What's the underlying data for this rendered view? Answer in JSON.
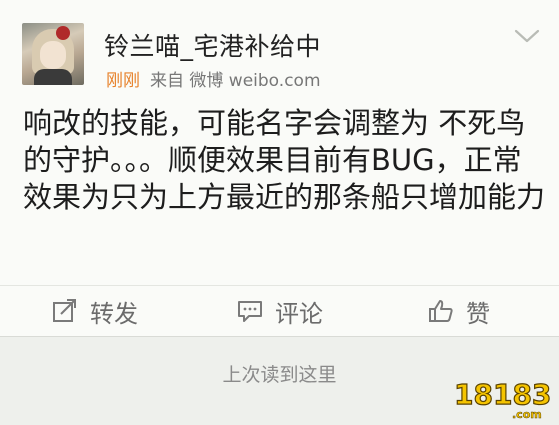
{
  "post": {
    "username": "铃兰喵_宅港补给中",
    "time": "刚刚",
    "source": "来自 微博 weibo.com",
    "content": "响改的技能，可能名字会调整为 不死鸟的守护。。。顺便效果目前有BUG，正常效果为只为上方最近的那条船只增加能力"
  },
  "actions": {
    "repost": "转发",
    "comment": "评论",
    "like": "赞"
  },
  "feed": {
    "last_read": "上次读到这里"
  },
  "watermark": {
    "text": "18183",
    "suffix": ".com"
  },
  "colors": {
    "time": "#e7822b",
    "text": "#1d1d1d",
    "muted": "#777777",
    "watermark_yellow": "#f5c400"
  },
  "icons": [
    "chevron-down-icon",
    "repost-icon",
    "comment-icon",
    "like-icon"
  ]
}
